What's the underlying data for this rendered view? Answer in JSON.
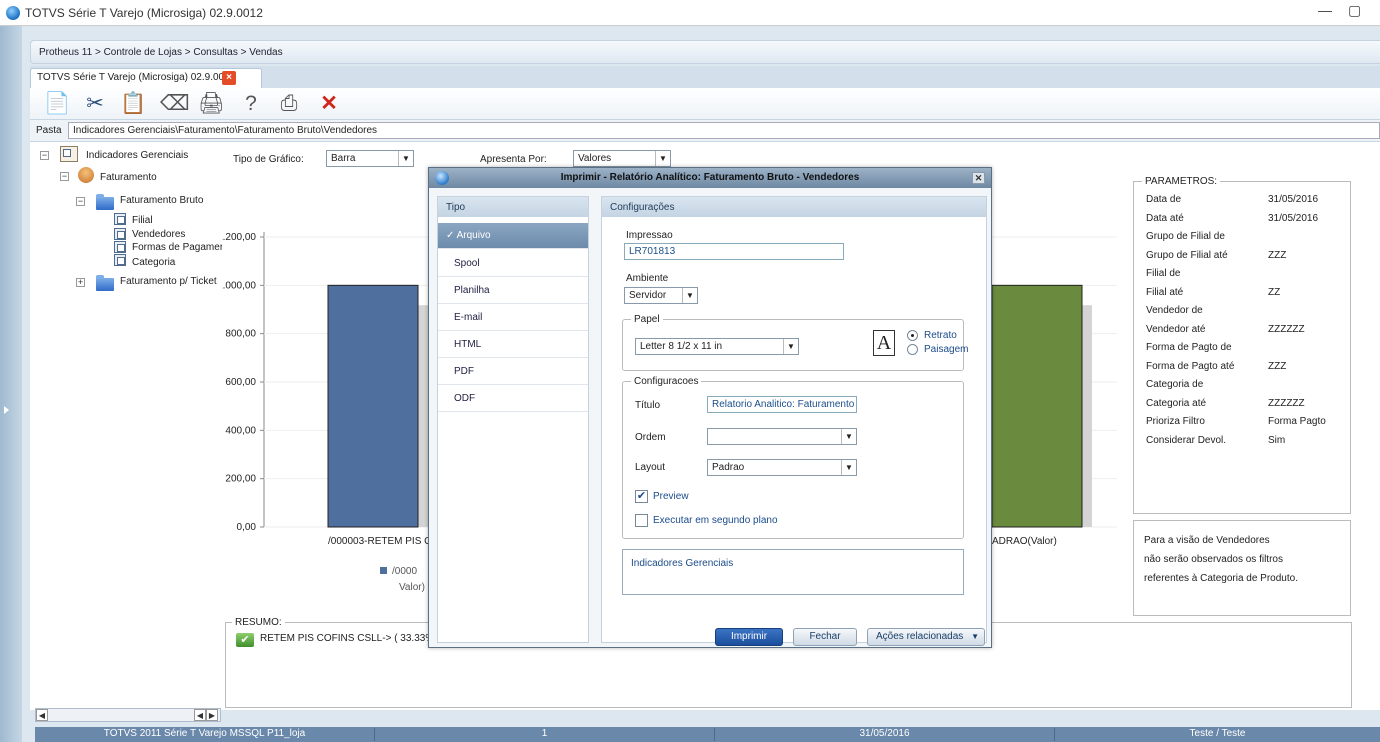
{
  "window": {
    "title": "TOTVS Série T Varejo (Microsiga) 02.9.0012",
    "minimize": "—",
    "restore": "▢"
  },
  "breadcrumb": "Protheus 11 > Controle de Lojas > Consultas > Vendas",
  "tab": {
    "label": "TOTVS Série T Varejo (Microsiga) 02.9.0012",
    "close": "×"
  },
  "toolbar": {
    "icons": [
      "copy-icon",
      "cut-icon",
      "paste-icon",
      "eraser-icon",
      "print-icon",
      "help-icon",
      "printer-icon",
      "exit-icon"
    ],
    "glyphs": [
      "📄",
      "✂",
      "📋",
      "⌫",
      "🖨",
      "?",
      "⎙",
      "✕"
    ]
  },
  "pasta": {
    "label": "Pasta",
    "path": "Indicadores Gerenciais\\Faturamento\\Faturamento Bruto\\Vendedores"
  },
  "tree": {
    "root": "Indicadores Gerenciais",
    "faturamento": "Faturamento",
    "faturamento_bruto": "Faturamento Bruto",
    "filial": "Filial",
    "vendedores": "Vendedores",
    "formas": "Formas de Pagamer",
    "categoria": "Categoria",
    "ticket": "Faturamento p/ Ticket"
  },
  "controls": {
    "tipo_grafico_label": "Tipo de Gráfico:",
    "tipo_grafico_value": "Barra",
    "apresenta_label": "Apresenta Por:",
    "apresenta_value": "Valores"
  },
  "chart_data": {
    "type": "bar",
    "yticks": [
      "1.200,00",
      "1.000,00",
      "800,00",
      "600,00",
      "400,00",
      "200,00",
      "0,00"
    ],
    "ylim": [
      0,
      1200
    ],
    "categories": [
      "/000003-RETEM PIS COF",
      "ADRAO(Valor)"
    ],
    "values": [
      1000,
      1000
    ],
    "colors": [
      "#4f6f9f",
      "#6a8a3e"
    ],
    "legend": [
      "/0000",
      "Valor)"
    ]
  },
  "params": {
    "title": "PARAMETROS:",
    "rows": [
      {
        "k": "Data de",
        "v": "31/05/2016"
      },
      {
        "k": "Data até",
        "v": "31/05/2016"
      },
      {
        "k": "Grupo de Filial de",
        "v": ""
      },
      {
        "k": "Grupo de Filial até",
        "v": "ZZZ"
      },
      {
        "k": "Filial de",
        "v": ""
      },
      {
        "k": "Filial até",
        "v": "ZZ"
      },
      {
        "k": "Vendedor de",
        "v": ""
      },
      {
        "k": "Vendedor até",
        "v": "ZZZZZZ"
      },
      {
        "k": "Forma de Pagto de",
        "v": ""
      },
      {
        "k": "Forma de Pagto até",
        "v": "ZZZ"
      },
      {
        "k": "Categoria de",
        "v": ""
      },
      {
        "k": "Categoria até",
        "v": "ZZZZZZ"
      },
      {
        "k": "Prioriza Filtro",
        "v": "Forma Pagto"
      },
      {
        "k": "Considerar Devol.",
        "v": "Sim"
      }
    ]
  },
  "note": {
    "l1": "Para a visão de Vendedores",
    "l2": "não serão observados os filtros",
    "l3": "referentes à Categoria de Produto."
  },
  "resumo": {
    "title": "RESUMO:",
    "text": "RETEM PIS COFINS CSLL-> ( 33.33%)"
  },
  "dialog": {
    "title": "Imprimir - Relatório Analítico: Faturamento Bruto - Vendedores",
    "tipo_header": "Tipo",
    "tipos": [
      "✓ Arquivo",
      "Spool",
      "Planilha",
      "E-mail",
      "HTML",
      "PDF",
      "ODF"
    ],
    "config_header": "Configurações",
    "impressao_label": "Impressao",
    "impressao_value": "LR701813",
    "ambiente_label": "Ambiente",
    "ambiente_value": "Servidor",
    "papel_label": "Papel",
    "papel_value": "Letter 8 1/2 x 11 in",
    "page_glyph": "A",
    "retrato": "Retrato",
    "paisagem": "Paisagem",
    "configuracoes_label": "Configuracoes",
    "titulo_label": "Título",
    "titulo_value": "Relatorio Analitico: Faturamento",
    "ordem_label": "Ordem",
    "ordem_value": "",
    "layout_label": "Layout",
    "layout_value": "Padrao",
    "preview_label": "Preview",
    "segundo_plano_label": "Executar em segundo plano",
    "info_text": "Indicadores Gerenciais",
    "btn_imprimir": "Imprimir",
    "btn_fechar": "Fechar",
    "btn_acoes": "Ações relacionadas"
  },
  "status": {
    "app": "TOTVS 2011 Série T Varejo MSSQL P11_loja",
    "num": "1",
    "date": "31/05/2016",
    "user": "Teste / Teste"
  },
  "dd_arrow": "▼",
  "check_mark": "✔"
}
